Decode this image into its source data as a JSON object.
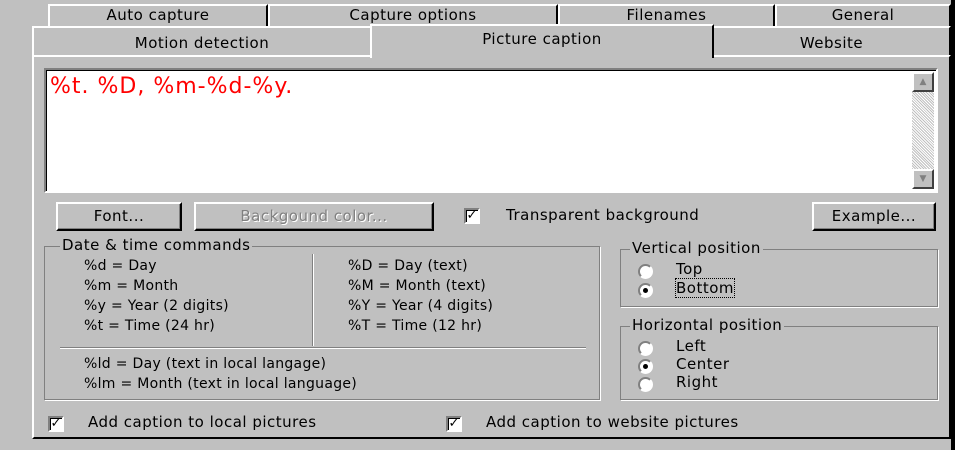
{
  "tabs_row1": [
    {
      "label": "Auto capture"
    },
    {
      "label": "Capture options"
    },
    {
      "label": "Filenames"
    },
    {
      "label": "General"
    }
  ],
  "tabs_row2": [
    {
      "label": "Motion detection"
    },
    {
      "label": "Picture caption",
      "active": true
    },
    {
      "label": "Website"
    }
  ],
  "caption": {
    "text": "%t. %D, %m-%d-%y.",
    "text_color": "#ff0000"
  },
  "buttons": {
    "font": "Font...",
    "background_color": "Backgound color...",
    "example": "Example..."
  },
  "transparent_background": {
    "label": "Transparent background",
    "checked": true
  },
  "date_time": {
    "title": "Date & time commands",
    "left": [
      "%d = Day",
      "%m = Month",
      "%y = Year (2 digits)",
      "%t = Time (24 hr)"
    ],
    "right": [
      "%D = Day (text)",
      "%M = Month (text)",
      "%Y = Year (4 digits)",
      "%T = Time (12 hr)"
    ],
    "local": [
      "%ld = Day (text in local langage)",
      "%lm = Month (text in local language)"
    ]
  },
  "vertical_position": {
    "title": "Vertical position",
    "options": [
      {
        "label": "Top",
        "selected": false
      },
      {
        "label": "Bottom",
        "selected": true
      }
    ]
  },
  "horizontal_position": {
    "title": "Horizontal position",
    "options": [
      {
        "label": "Left",
        "selected": false
      },
      {
        "label": "Center",
        "selected": true
      },
      {
        "label": "Right",
        "selected": false
      }
    ]
  },
  "add_caption_local": {
    "label": "Add caption to local pictures",
    "checked": true
  },
  "add_caption_website": {
    "label": "Add caption to website pictures",
    "checked": true
  }
}
